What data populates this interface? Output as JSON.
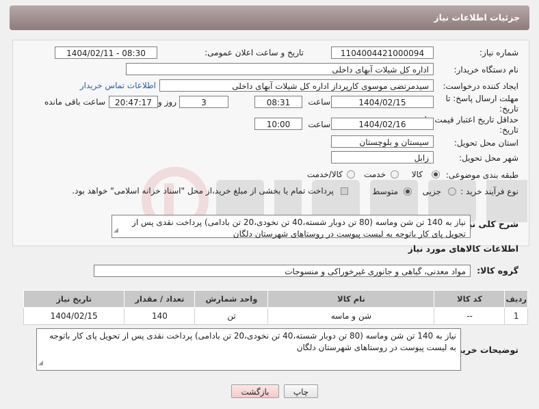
{
  "header": {
    "title": "جزئیات اطلاعات نیاز"
  },
  "form": {
    "need_number_label": "شماره نیاز:",
    "need_number": "1104004421000094",
    "announce_label": "تاریخ و ساعت اعلان عمومی:",
    "announce_value": "1404/02/11 - 08:30",
    "buyer_org_label": "نام دستگاه خریدار:",
    "buyer_org": "اداره کل شیلات آبهای داخلی",
    "creator_label": "ایجاد کننده درخواست:",
    "creator": "سیدمرتضی موسوی کارپرداز اداره کل شیلات آبهای داخلی",
    "contact_link": "اطلاعات تماس خریدار",
    "deadline_label": "مهلت ارسال پاسخ: تا تاریخ:",
    "deadline_date": "1404/02/15",
    "time_label": "ساعت",
    "deadline_time": "08:31",
    "days_value": "3",
    "days_label": "روز و",
    "remaining_time": "20:47:17",
    "remaining_label": "ساعت باقی مانده",
    "validity_label": "حداقل تاریخ اعتبار قیمت: تا تاریخ:",
    "validity_date": "1404/02/16",
    "validity_time": "10:00",
    "province_label": "استان محل تحویل:",
    "province": "سیستان و بلوچستان",
    "city_label": "شهر محل تحویل:",
    "city": "زابل",
    "category_label": "طبقه بندی موضوعی:",
    "category_options": [
      "کالا",
      "خدمت",
      "کالا/خدمت"
    ],
    "process_label": "نوع فرآیند خرید :",
    "process_options": [
      "جزیی",
      "متوسط"
    ],
    "payment_note": "پرداخت تمام یا بخشی از مبلغ خرید،از محل \"اسناد خزانه اسلامی\" خواهد بود."
  },
  "description": {
    "label": "شرح کلی نیاز:",
    "text": "نیاز به 140 تن شن وماسه (80 تن دوبار شسته،40 تن نخودی،20 تن بادامی) پرداخت نقدی پس از تحویل پای کار باتوجه به لیست پیوست در روستاهای شهرستان دلگان"
  },
  "goods": {
    "section_title": "اطلاعات کالاهای مورد نیاز",
    "group_label": "گروه کالا:",
    "group_value": "مواد معدنی، گیاهی و جانوری غیرخوراکی و منسوجات",
    "columns": [
      "ردیف",
      "کد کالا",
      "نام کالا",
      "واحد شمارش",
      "تعداد / مقدار",
      "تاریخ نیاز"
    ],
    "rows": [
      [
        "1",
        "--",
        "شن و ماسه",
        "تن",
        "140",
        "1404/02/15"
      ]
    ]
  },
  "buyer_notes": {
    "label": "توضیحات خریدار:",
    "text": "نیاز به 140 تن شن وماسه (80 تن دوبار شسته،40 تن نخودی،20 تن بادامی) پرداخت نقدی پس از تحویل پای کار باتوجه به لیست پیوست در روستاهای شهرستان دلگان"
  },
  "buttons": {
    "print": "چاپ",
    "back": "بازگشت"
  },
  "colors": {
    "header": "#9a8888",
    "link": "#2a5db0",
    "back_button_bg": "#f8d8d8"
  }
}
